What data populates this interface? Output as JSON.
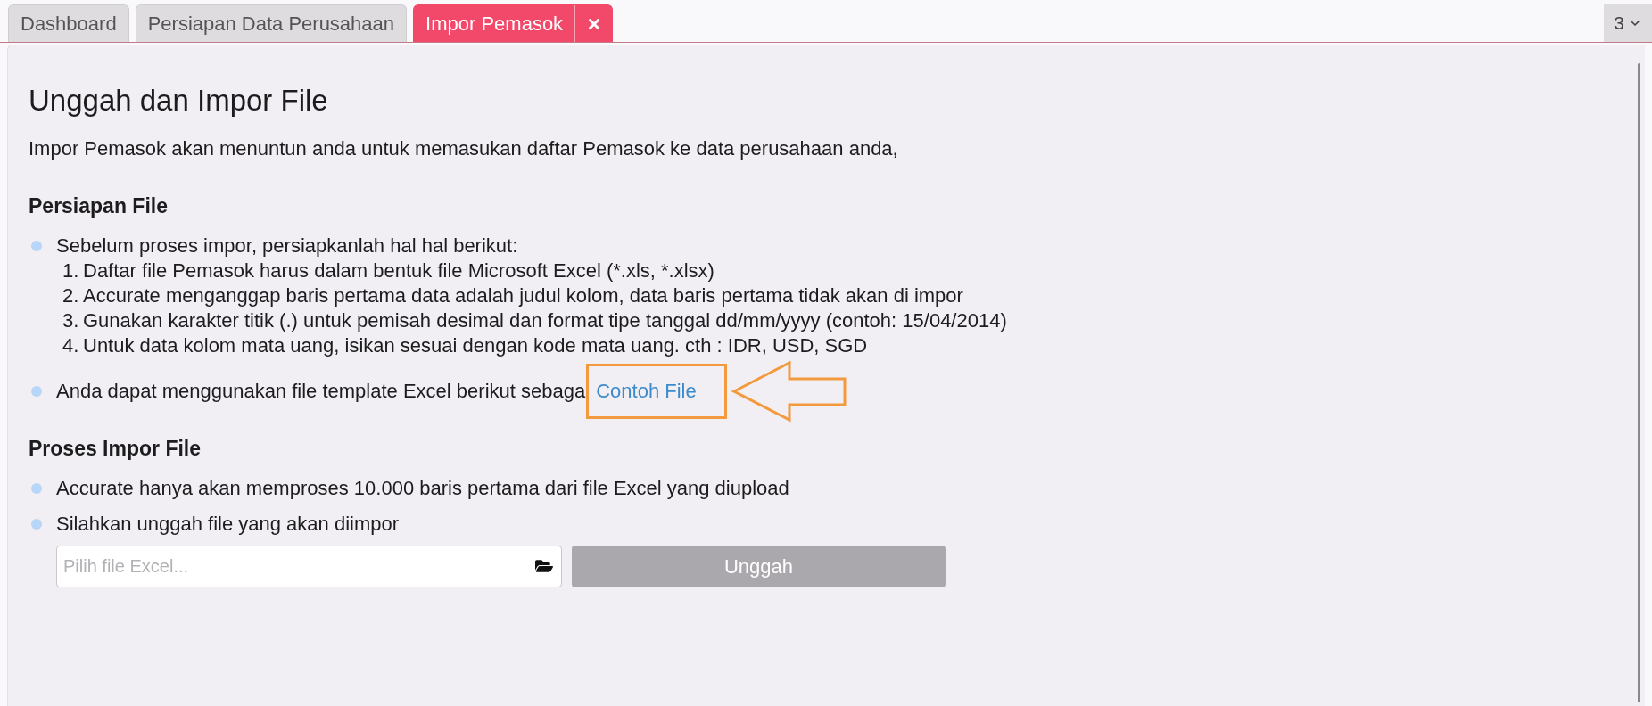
{
  "tabs": [
    {
      "label": "Dashboard",
      "selected": false,
      "closable": false
    },
    {
      "label": "Persiapan Data Perusahaan",
      "selected": false,
      "closable": false
    },
    {
      "label": "Impor Pemasok",
      "selected": true,
      "closable": true
    }
  ],
  "tab_overflow": {
    "count": "3"
  },
  "page": {
    "title": "Unggah dan Impor File",
    "intro": "Impor Pemasok akan menuntun anda untuk memasukan daftar Pemasok ke data perusahaan anda,",
    "sections": [
      {
        "heading": "Persiapan File",
        "items": [
          {
            "kind": "list",
            "text": "Sebelum proses impor, persiapkanlah hal hal berikut:",
            "steps": [
              {
                "number": "1.",
                "text": "Daftar file Pemasok harus dalam bentuk file Microsoft Excel (*.xls, *.xlsx)"
              },
              {
                "number": "2.",
                "text": "Accurate menganggap baris pertama data adalah judul kolom, data baris pertama tidak akan di impor"
              },
              {
                "number": "3.",
                "text": "Gunakan karakter titik (.) untuk pemisah desimal dan format tipe tanggal dd/mm/yyyy (contoh: 15/04/2014)"
              },
              {
                "number": "4.",
                "text": "Untuk data kolom mata uang, isikan sesuai dengan kode mata uang. cth : IDR, USD, SGD"
              }
            ]
          },
          {
            "kind": "link",
            "text": "Anda dapat menggunakan file template Excel berikut sebaga",
            "link": "Contoh File",
            "highlighted": true
          }
        ]
      },
      {
        "heading": "Proses Impor File",
        "items": [
          {
            "kind": "text",
            "text": "Accurate hanya akan memproses 10.000 baris pertama dari file Excel yang diupload"
          },
          {
            "kind": "upload",
            "text": "Silahkan unggah file yang akan diimpor",
            "field": {
              "placeholder": "Pilih file Excel..."
            },
            "button": {
              "label": "Unggah",
              "disabled": true
            }
          }
        ]
      }
    ]
  }
}
